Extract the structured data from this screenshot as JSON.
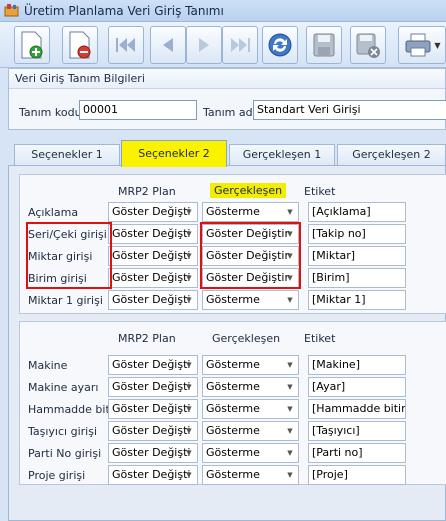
{
  "window": {
    "title": "Üretim Planlama Veri Giriş Tanımı"
  },
  "toolbar": {
    "buttons": [
      "new-document",
      "delete-document",
      "first-record",
      "previous-record",
      "next-record",
      "last-record",
      "refresh",
      "save",
      "save-cancel",
      "print"
    ]
  },
  "info_panel": {
    "header": "Veri Giriş Tanım Bilgileri",
    "code_label": "Tanım kodu",
    "code_value": "00001",
    "name_label": "Tanım adı",
    "name_value": "Standart Veri Girişi"
  },
  "tabs": [
    {
      "label": "Seçenekler 1",
      "active": false
    },
    {
      "label": "Seçenekler 2",
      "active": true
    },
    {
      "label": "Gerçekleşen 1",
      "active": false
    },
    {
      "label": "Gerçekleşen 2",
      "active": false
    }
  ],
  "group1": {
    "headers": {
      "plan": "MRP2 Plan",
      "actual": "Gerçekleşen",
      "label": "Etiket"
    },
    "rows": [
      {
        "name": "Açıklama",
        "plan": "Göster Değişti",
        "actual": "Gösterme",
        "label": "[Açıklama]"
      },
      {
        "name": "Seri/Çeki girişi",
        "plan": "Göster Değişti",
        "actual": "Göster Değiştir",
        "label": "[Takip no]"
      },
      {
        "name": "Miktar girişi",
        "plan": "Göster Değişti",
        "actual": "Göster Değiştir",
        "label": "[Miktar]"
      },
      {
        "name": "Birim girişi",
        "plan": "Göster Değişti",
        "actual": "Göster Değiştir",
        "label": "[Birim]"
      },
      {
        "name": "Miktar 1 girişi",
        "plan": "Göster Değişti",
        "actual": "Gösterme",
        "label": "[Miktar 1]"
      }
    ]
  },
  "group2": {
    "headers": {
      "plan": "MRP2 Plan",
      "actual": "Gerçekleşen",
      "label": "Etiket"
    },
    "rows": [
      {
        "name": "Makine",
        "plan": "Göster Değişti",
        "actual": "Gösterme",
        "label": "[Makine]"
      },
      {
        "name": "Makine ayarı",
        "plan": "Göster Değişti",
        "actual": "Gösterme",
        "label": "[Ayar]"
      },
      {
        "name": "Hammadde bitir",
        "plan": "Göster Değişti",
        "actual": "Gösterme",
        "label": "[Hammadde bitir]"
      },
      {
        "name": "Taşıyıcı girişi",
        "plan": "Göster Değişti",
        "actual": "Gösterme",
        "label": "[Taşıyıcı]"
      },
      {
        "name": "Parti No girişi",
        "plan": "Göster Değişti",
        "actual": "Gösterme",
        "label": "[Parti no]"
      },
      {
        "name": "Proje girişi",
        "plan": "Göster Değişti",
        "actual": "Gösterme",
        "label": "[Proje]"
      }
    ]
  },
  "colors": {
    "highlight": "#f3ed00",
    "annotation_red": "#e01010",
    "active_tab": "#fbf200"
  }
}
